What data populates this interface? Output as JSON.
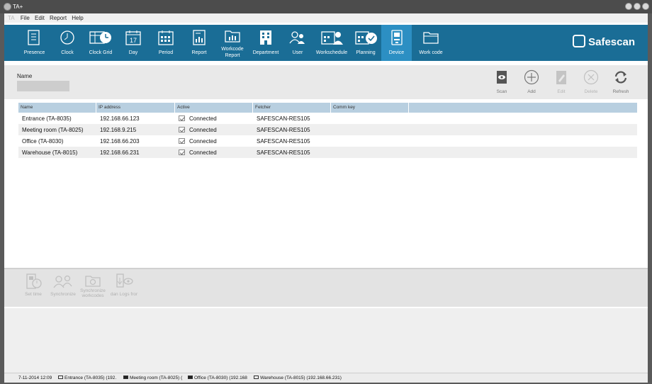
{
  "window": {
    "title": "TA+"
  },
  "menu": {
    "app_label": "TA",
    "items": [
      "File",
      "Edit",
      "Report",
      "Help"
    ]
  },
  "toolbar": {
    "items": [
      {
        "label": "Presence",
        "icon": "presence-icon"
      },
      {
        "label": "Clock",
        "icon": "clock-icon"
      },
      {
        "label": "Clock Grid",
        "icon": "clock-grid-icon"
      },
      {
        "label": "Day",
        "icon": "day-calendar-icon",
        "day_number": "17"
      },
      {
        "label": "Period",
        "icon": "period-calendar-icon"
      },
      {
        "label": "Report",
        "icon": "report-icon"
      },
      {
        "label": "Workcode Report",
        "label_line1": "Workcode",
        "label_line2": "Report",
        "icon": "workcode-report-icon"
      },
      {
        "label": "Department",
        "icon": "department-icon"
      },
      {
        "label": "User",
        "icon": "user-icon"
      },
      {
        "label": "Workschedule",
        "icon": "workschedule-icon"
      },
      {
        "label": "Planning",
        "icon": "planning-icon"
      },
      {
        "label": "Device",
        "icon": "device-icon",
        "active": true
      },
      {
        "label": "Work code",
        "icon": "work-code-icon"
      }
    ],
    "brand": "Safescan",
    "accent_color": "#1a6d96",
    "active_color": "#2c8fc3"
  },
  "filter": {
    "name_label": "Name",
    "name_value": ""
  },
  "actions": {
    "scan": "Scan",
    "add": "Add",
    "edit": "Edit",
    "delete": "Delete",
    "refresh": "Refresh"
  },
  "table": {
    "columns": [
      "Name",
      "IP address",
      "Active",
      "Fetcher",
      "Comm key"
    ],
    "rows": [
      {
        "name": "Entrance (TA-8035)",
        "ip": "192.168.66.123",
        "active": "Connected",
        "fetcher": "SAFESCAN-RES105",
        "comm_key": ""
      },
      {
        "name": "Meeting room (TA-8025)",
        "ip": "192.168.9.215",
        "active": "Connected",
        "fetcher": "SAFESCAN-RES105",
        "comm_key": ""
      },
      {
        "name": "Office (TA-8030)",
        "ip": "192.168.66.203",
        "active": "Connected",
        "fetcher": "SAFESCAN-RES105",
        "comm_key": ""
      },
      {
        "name": "Warehouse (TA-8015)",
        "ip": "192.168.66.231",
        "active": "Connected",
        "fetcher": "SAFESCAN-RES105",
        "comm_key": ""
      }
    ]
  },
  "sync_actions": {
    "set_time": "Set time",
    "synchronize": "Synchronize",
    "sync_workcodes_line1": "Synchronize",
    "sync_workcodes_line2": "workcodes",
    "logs": "Logs fror",
    "logs_prefix": "dan"
  },
  "status": {
    "datetime": "7-11-2014 12:09",
    "devices": [
      "Entrance (TA-8035) (192.",
      "Meeting room (TA-8025) (",
      "Office (TA-8030) (192.168",
      "Warehouse (TA-8015) (192.168.66.231)"
    ]
  }
}
